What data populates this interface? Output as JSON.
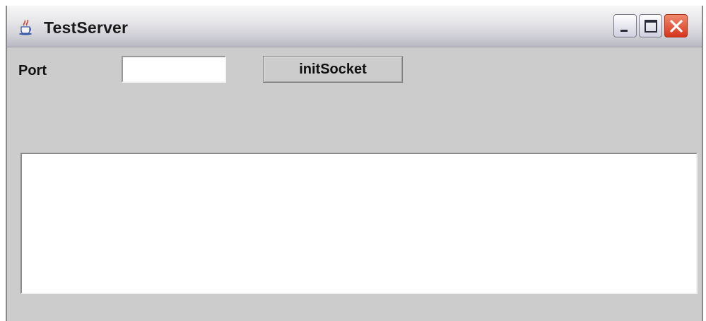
{
  "window": {
    "title": "TestServer",
    "icons": {
      "app": "java-coffee-cup-icon",
      "minimize": "minimize-icon",
      "maximize": "maximize-icon",
      "close": "close-icon"
    },
    "colors": {
      "title_bar": "#dcdce2",
      "panel": "#cccccc",
      "close_button": "#d6341c"
    }
  },
  "form": {
    "port_label": "Port",
    "port_value": "",
    "init_button_label": "initSocket"
  },
  "output": {
    "text": ""
  }
}
